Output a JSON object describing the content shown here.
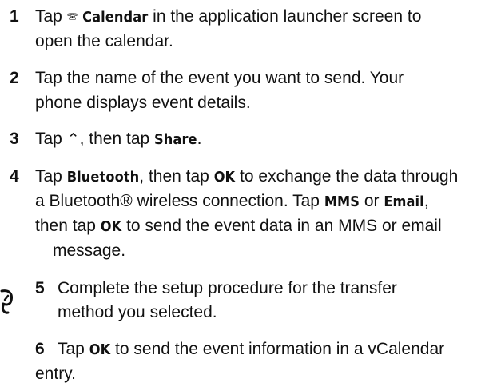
{
  "steps": [
    {
      "number": "1",
      "lines": [
        {
          "pre": "Tap ",
          "icon": "🕾",
          "kw": "Calendar",
          "post": " in the application launcher screen to"
        },
        {
          "text": "open the calendar."
        }
      ]
    },
    {
      "number": "2",
      "lines": [
        {
          "text": "Tap the name of the event you want to send. Your"
        },
        {
          "text": "phone displays event details."
        }
      ]
    },
    {
      "number": "3",
      "lines": [
        {
          "pre": "Tap ",
          "icon": "⌃",
          "mid": ", then tap ",
          "kw": "Share",
          "post": "."
        }
      ]
    },
    {
      "number": "4",
      "lines": [
        {
          "pre": "Tap ",
          "kw": "Bluetooth",
          "mid": ", then tap ",
          "kw2": "OK",
          "post": " to exchange the data through"
        },
        {
          "pre": "a Bluetooth® wireless connection. Tap ",
          "kw": "MMS",
          "mid": " or ",
          "kw2": "Email",
          "post": ","
        },
        {
          "pre": "then tap ",
          "kw": "OK",
          "post": " to send the event data in an MMS or email"
        },
        {
          "text": "message."
        }
      ]
    },
    {
      "number": "5",
      "lines": [
        {
          "text": "Complete the setup procedure for the transfer"
        },
        {
          "text": "method you selected."
        }
      ]
    },
    {
      "number": "6",
      "lines": [
        {
          "pre": "Tap ",
          "kw": "OK",
          "post": " to send the event information in a vCalendar"
        },
        {
          "text": "entry."
        }
      ]
    }
  ]
}
